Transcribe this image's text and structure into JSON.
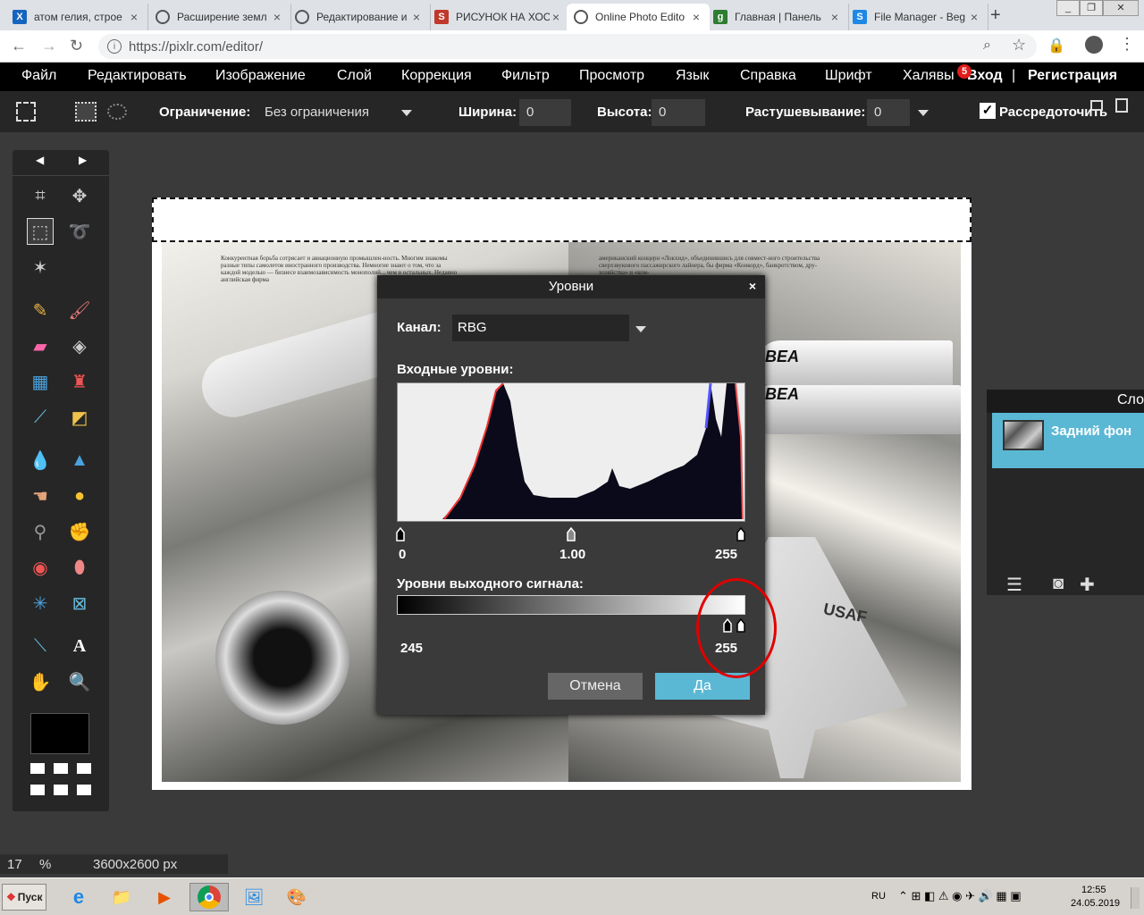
{
  "browser": {
    "tabs": [
      {
        "title": "атом гелия, строе",
        "favicon_color": "#1565c0",
        "favicon_glyph": "X"
      },
      {
        "title": "Расширение земл",
        "favicon_color": "#555555",
        "favicon_glyph": ""
      },
      {
        "title": "Редактирование и",
        "favicon_color": "#555555",
        "favicon_glyph": ""
      },
      {
        "title": "РИСУНОК НА ХОС",
        "favicon_color": "#c0392b",
        "favicon_glyph": "S"
      },
      {
        "title": "Online Photo Edito",
        "favicon_color": "#555555",
        "favicon_glyph": ""
      },
      {
        "title": "Главная | Панель",
        "favicon_color": "#2e7d32",
        "favicon_glyph": "g"
      },
      {
        "title": "File Manager - Beg",
        "favicon_color": "#1e88e5",
        "favicon_glyph": "S"
      }
    ],
    "active_tab": 4,
    "new_tab": "+",
    "url": "https://pixlr.com/editor/"
  },
  "menu": {
    "items": [
      "Файл",
      "Редактировать",
      "Изображение",
      "Слой",
      "Коррекция",
      "Фильтр",
      "Просмотр",
      "Язык",
      "Справка",
      "Шрифт",
      "Халявы"
    ],
    "badge": "5",
    "login": "Вход",
    "separator": "|",
    "register": "Регистрация"
  },
  "options": {
    "constraint_label": "Ограничение:",
    "constraint_value": "Без ограничения",
    "width_label": "Ширина:",
    "width_value": "0",
    "height_label": "Высота:",
    "height_value": "0",
    "feather_label": "Растушевывание:",
    "feather_value": "0",
    "antialias_label": "Рассредоточить"
  },
  "toolbox": {
    "nav_left": "◀",
    "nav_right": "▶"
  },
  "photo_text": {
    "left": "Конкурентная борьба сотрясает и авиационную промышлен-ность. Многим знакомы разные типы самолетов иностранного производства. Немногие знают о том, что за каждой моделью — бизнесе взаимозависимость монополий... чем в остальных. Недавно английская фирма",
    "right": "американский концерн «Локхид», объединившись для совмест-ного строительства сверхзвукового пассажирского лайнера, бы фирма «Конкорд», банкротством, дру- хозяйства» и «ком-",
    "markings_bea": "BEA",
    "markings_usaf": "USAF"
  },
  "layers": {
    "header": "Сло",
    "layer_name": "Задний фон"
  },
  "status": {
    "zoom": "17",
    "percent": "%",
    "size": "3600x2600 px"
  },
  "taskbar": {
    "start": "Пуск",
    "lang": "RU",
    "time": "12:55",
    "date": "24.05.2019"
  },
  "dialog": {
    "title": "Уровни",
    "close": "×",
    "channel_label": "Канал:",
    "channel_value": "RBG",
    "input_label": "Входные уровни:",
    "input_min": "0",
    "input_mid": "1.00",
    "input_max": "255",
    "output_label": "Уровни выходного сигнала:",
    "output_min": "245",
    "output_max": "255",
    "cancel": "Отмена",
    "ok": "Да"
  },
  "colors": {
    "accent": "#5bb8d5",
    "annotation": "#e00000"
  }
}
